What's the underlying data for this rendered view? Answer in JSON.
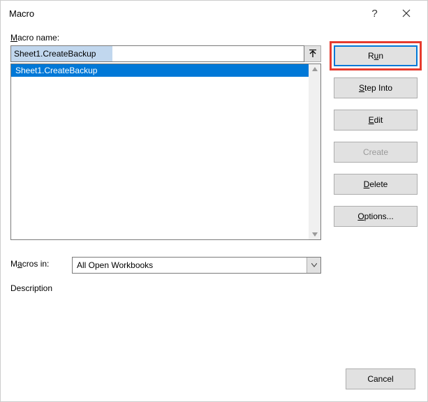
{
  "titlebar": {
    "title": "Macro",
    "help": "?",
    "close_icon": "close-icon"
  },
  "labels": {
    "macro_name": "Macro name:",
    "macros_in": "Macros in:",
    "description": "Description"
  },
  "input": {
    "macro_name_value": "Sheet1.CreateBackup"
  },
  "list": {
    "items": [
      "Sheet1.CreateBackup"
    ]
  },
  "dropdown": {
    "selected": "All Open Workbooks"
  },
  "buttons": {
    "run_prefix": "R",
    "run_accel": "u",
    "run_suffix": "n",
    "step_prefix": "",
    "step_accel": "S",
    "step_suffix": "tep Into",
    "edit_prefix": "",
    "edit_accel": "E",
    "edit_suffix": "dit",
    "create": "Create",
    "delete_prefix": "",
    "delete_accel": "D",
    "delete_suffix": "elete",
    "options_prefix": "",
    "options_accel": "O",
    "options_suffix": "ptions...",
    "cancel": "Cancel"
  }
}
